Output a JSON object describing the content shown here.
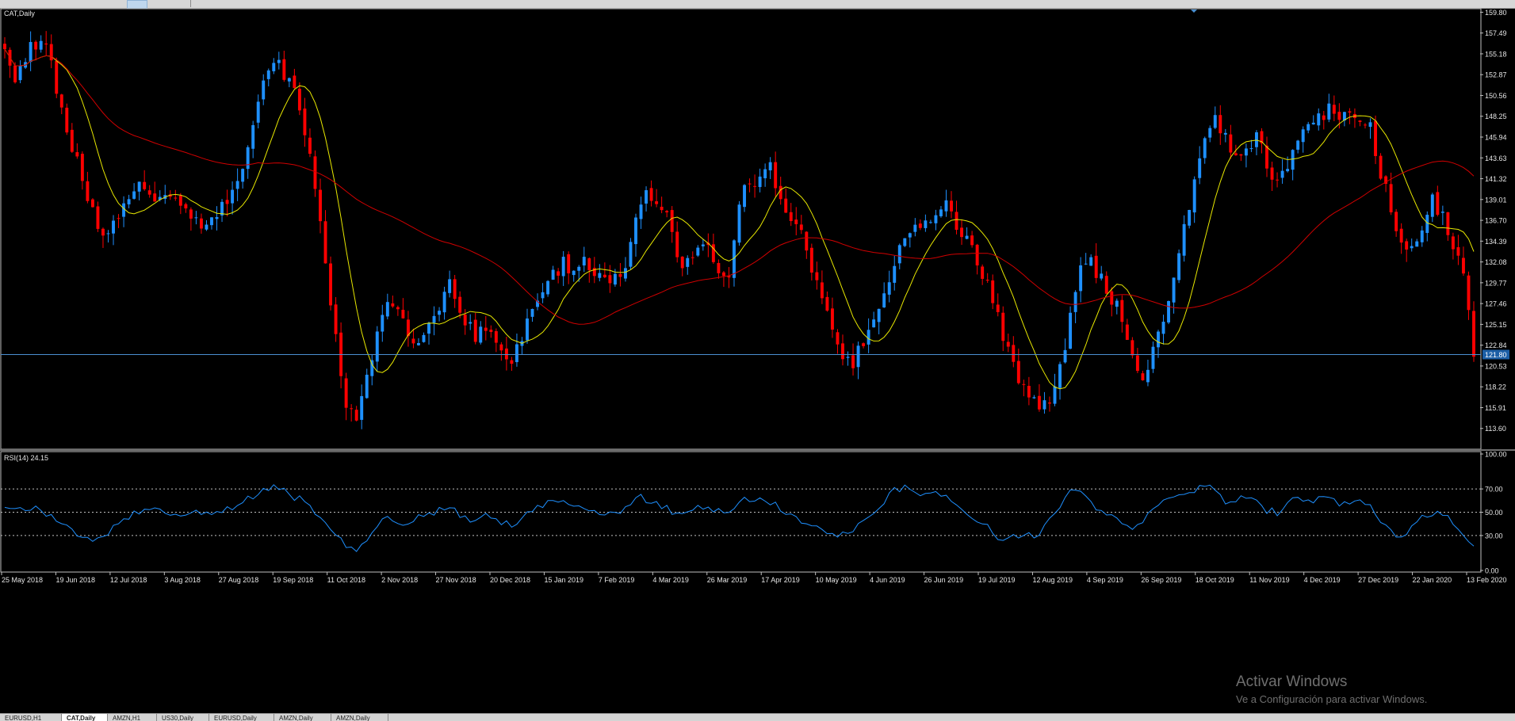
{
  "window": {
    "tabs": [
      "EURUSD,H1",
      "CAT,Daily",
      "AMZN,H1",
      "US30,Daily",
      "EURUSD,Daily",
      "AMZN,Daily",
      "AMZN,Daily"
    ],
    "active_tab": 1
  },
  "watermark": {
    "title": "Activar Windows",
    "subtitle": "Ve a Configuración para activar Windows."
  },
  "chart_data": [
    {
      "type": "candlestick",
      "title": "CAT,Daily",
      "ylim": [
        111.29,
        160.1
      ],
      "y_ticks": [
        "159.80",
        "157.49",
        "155.18",
        "152.87",
        "150.56",
        "148.25",
        "145.94",
        "143.63",
        "141.32",
        "139.01",
        "136.70",
        "134.39",
        "132.08",
        "129.77",
        "127.46",
        "125.15",
        "122.84",
        "120.53",
        "118.22",
        "115.91",
        "113.60"
      ],
      "current_price": "121.80",
      "x_labels": [
        "25 May 2018",
        "19 Jun 2018",
        "12 Jul 2018",
        "3 Aug 2018",
        "27 Aug 2018",
        "19 Sep 2018",
        "11 Oct 2018",
        "2 Nov 2018",
        "27 Nov 2018",
        "20 Dec 2018",
        "15 Jan 2019",
        "7 Feb 2019",
        "4 Mar 2019",
        "26 Mar 2019",
        "17 Apr 2019",
        "10 May 2019",
        "4 Jun 2019",
        "26 Jun 2019",
        "19 Jul 2019",
        "12 Aug 2019",
        "4 Sep 2019",
        "26 Sep 2019",
        "18 Oct 2019",
        "11 Nov 2019",
        "4 Dec 2019",
        "27 Dec 2019",
        "22 Jan 2020",
        "13 Feb 2020"
      ],
      "bull_color": "#1e90ff",
      "bear_color": "#ff0000",
      "close_path": [
        [
          0,
          156.5
        ],
        [
          2,
          152
        ],
        [
          5,
          156
        ],
        [
          8,
          157
        ],
        [
          10,
          151
        ],
        [
          13,
          145
        ],
        [
          16,
          139
        ],
        [
          19,
          135
        ],
        [
          21,
          136
        ],
        [
          23,
          138
        ],
        [
          26,
          141
        ],
        [
          29,
          139
        ],
        [
          32,
          140
        ],
        [
          35,
          138
        ],
        [
          38,
          136
        ],
        [
          41,
          137
        ],
        [
          43,
          139
        ],
        [
          46,
          143
        ],
        [
          49,
          150
        ],
        [
          51,
          154
        ],
        [
          53,
          154
        ],
        [
          56,
          151
        ],
        [
          59,
          144
        ],
        [
          62,
          132
        ],
        [
          64,
          124
        ],
        [
          66,
          116
        ],
        [
          68,
          114
        ],
        [
          70,
          119
        ],
        [
          72,
          124
        ],
        [
          74,
          128
        ],
        [
          77,
          126
        ],
        [
          79,
          123
        ],
        [
          82,
          125
        ],
        [
          84,
          127
        ],
        [
          86,
          130
        ],
        [
          88,
          126
        ],
        [
          91,
          124
        ],
        [
          93,
          125
        ],
        [
          96,
          122
        ],
        [
          98,
          121
        ],
        [
          100,
          124
        ],
        [
          103,
          128
        ],
        [
          105,
          130
        ],
        [
          108,
          132
        ],
        [
          110,
          131
        ],
        [
          112,
          132
        ],
        [
          114,
          131
        ],
        [
          117,
          129
        ],
        [
          120,
          132
        ],
        [
          122,
          137
        ],
        [
          124,
          140
        ],
        [
          126,
          138
        ],
        [
          128,
          137
        ],
        [
          131,
          131
        ],
        [
          133,
          133
        ],
        [
          136,
          134
        ],
        [
          138,
          131
        ],
        [
          140,
          131
        ],
        [
          142,
          139
        ],
        [
          144,
          141
        ],
        [
          146,
          141
        ],
        [
          148,
          143
        ],
        [
          150,
          139
        ],
        [
          152,
          137
        ],
        [
          154,
          135
        ],
        [
          156,
          131
        ],
        [
          158,
          128
        ],
        [
          160,
          125
        ],
        [
          162,
          122
        ],
        [
          164,
          121
        ],
        [
          166,
          123
        ],
        [
          168,
          126
        ],
        [
          170,
          129
        ],
        [
          172,
          132
        ],
        [
          174,
          135
        ],
        [
          176,
          137
        ],
        [
          178,
          136
        ],
        [
          180,
          137
        ],
        [
          182,
          139
        ],
        [
          184,
          136
        ],
        [
          186,
          135
        ],
        [
          188,
          132
        ],
        [
          190,
          130
        ],
        [
          192,
          126
        ],
        [
          194,
          122
        ],
        [
          196,
          119
        ],
        [
          198,
          117
        ],
        [
          200,
          116
        ],
        [
          202,
          117
        ],
        [
          204,
          120
        ],
        [
          206,
          126
        ],
        [
          208,
          132
        ],
        [
          210,
          132
        ],
        [
          212,
          130
        ],
        [
          214,
          128
        ],
        [
          216,
          126
        ],
        [
          218,
          122
        ],
        [
          220,
          119
        ],
        [
          222,
          122
        ],
        [
          224,
          126
        ],
        [
          226,
          131
        ],
        [
          228,
          136
        ],
        [
          230,
          141
        ],
        [
          232,
          146
        ],
        [
          234,
          148
        ],
        [
          236,
          146
        ],
        [
          238,
          144
        ],
        [
          240,
          145
        ],
        [
          242,
          146
        ],
        [
          244,
          143
        ],
        [
          246,
          141
        ],
        [
          248,
          143
        ],
        [
          250,
          146
        ],
        [
          252,
          148
        ],
        [
          254,
          148
        ],
        [
          256,
          149
        ],
        [
          258,
          148
        ],
        [
          260,
          148
        ],
        [
          262,
          148
        ],
        [
          264,
          147
        ],
        [
          266,
          142
        ],
        [
          268,
          138
        ],
        [
          270,
          134
        ],
        [
          272,
          134
        ],
        [
          274,
          136
        ],
        [
          276,
          139
        ],
        [
          278,
          137
        ],
        [
          280,
          134
        ],
        [
          282,
          130
        ],
        [
          283,
          126
        ],
        [
          284,
          122
        ]
      ]
    },
    {
      "type": "line",
      "title": "RSI(14) 24.15",
      "ylim": [
        0,
        100
      ],
      "y_ticks": [
        "100.00",
        "70.00",
        "50.00",
        "30.00",
        "0.00"
      ],
      "levels": [
        70,
        50,
        30
      ],
      "series_color": "#1e90ff",
      "values_path": [
        [
          0,
          52
        ],
        [
          5,
          55
        ],
        [
          10,
          42
        ],
        [
          14,
          30
        ],
        [
          18,
          26
        ],
        [
          21,
          38
        ],
        [
          26,
          50
        ],
        [
          30,
          52
        ],
        [
          34,
          46
        ],
        [
          38,
          50
        ],
        [
          42,
          49
        ],
        [
          46,
          58
        ],
        [
          50,
          68
        ],
        [
          52,
          72
        ],
        [
          55,
          66
        ],
        [
          58,
          58
        ],
        [
          62,
          38
        ],
        [
          66,
          22
        ],
        [
          68,
          18
        ],
        [
          70,
          28
        ],
        [
          73,
          44
        ],
        [
          77,
          42
        ],
        [
          80,
          46
        ],
        [
          84,
          52
        ],
        [
          86,
          56
        ],
        [
          88,
          45
        ],
        [
          91,
          44
        ],
        [
          94,
          47
        ],
        [
          97,
          40
        ],
        [
          99,
          40
        ],
        [
          101,
          47
        ],
        [
          104,
          57
        ],
        [
          106,
          58
        ],
        [
          109,
          58
        ],
        [
          112,
          55
        ],
        [
          115,
          49
        ],
        [
          118,
          48
        ],
        [
          121,
          58
        ],
        [
          123,
          62
        ],
        [
          126,
          58
        ],
        [
          129,
          51
        ],
        [
          131,
          46
        ],
        [
          134,
          54
        ],
        [
          137,
          52
        ],
        [
          139,
          48
        ],
        [
          142,
          60
        ],
        [
          144,
          62
        ],
        [
          147,
          62
        ],
        [
          150,
          52
        ],
        [
          152,
          48
        ],
        [
          154,
          44
        ],
        [
          156,
          38
        ],
        [
          158,
          34
        ],
        [
          161,
          32
        ],
        [
          163,
          30
        ],
        [
          165,
          40
        ],
        [
          167,
          48
        ],
        [
          170,
          58
        ],
        [
          172,
          68
        ],
        [
          174,
          72
        ],
        [
          176,
          68
        ],
        [
          178,
          64
        ],
        [
          180,
          68
        ],
        [
          182,
          64
        ],
        [
          184,
          56
        ],
        [
          186,
          48
        ],
        [
          188,
          44
        ],
        [
          190,
          36
        ],
        [
          192,
          30
        ],
        [
          194,
          28
        ],
        [
          197,
          28
        ],
        [
          200,
          32
        ],
        [
          202,
          42
        ],
        [
          204,
          55
        ],
        [
          206,
          67
        ],
        [
          208,
          66
        ],
        [
          210,
          58
        ],
        [
          212,
          52
        ],
        [
          214,
          50
        ],
        [
          216,
          38
        ],
        [
          218,
          34
        ],
        [
          220,
          42
        ],
        [
          222,
          52
        ],
        [
          224,
          60
        ],
        [
          226,
          62
        ],
        [
          228,
          64
        ],
        [
          230,
          68
        ],
        [
          232,
          72
        ],
        [
          234,
          68
        ],
        [
          236,
          60
        ],
        [
          238,
          60
        ],
        [
          240,
          62
        ],
        [
          242,
          60
        ],
        [
          244,
          52
        ],
        [
          246,
          50
        ],
        [
          248,
          58
        ],
        [
          250,
          60
        ],
        [
          252,
          58
        ],
        [
          254,
          62
        ],
        [
          256,
          60
        ],
        [
          258,
          58
        ],
        [
          260,
          56
        ],
        [
          262,
          58
        ],
        [
          264,
          54
        ],
        [
          266,
          44
        ],
        [
          268,
          36
        ],
        [
          270,
          26
        ],
        [
          272,
          40
        ],
        [
          274,
          46
        ],
        [
          276,
          50
        ],
        [
          278,
          46
        ],
        [
          280,
          42
        ],
        [
          282,
          30
        ],
        [
          283,
          26
        ],
        [
          284,
          24
        ]
      ]
    }
  ]
}
